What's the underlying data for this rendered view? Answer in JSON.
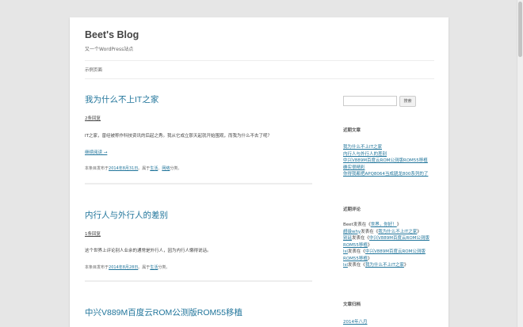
{
  "site": {
    "title": "Beet's Blog",
    "description": "又一个WordPress站点"
  },
  "nav": {
    "sample_page": "示例页面"
  },
  "posts": [
    {
      "title": "我为什么不上IT之家",
      "comments": "2条回复",
      "excerpt": "IT之家，曾经被称作科技资讯的后起之秀。我从它成立那天起就开始围观，而我为什么不去了呢？",
      "more": "继续阅读 →",
      "meta_prefix": "本条目发布于",
      "date": "2014年8月31日",
      "meta_mid": "。属于",
      "cat1": "生活",
      "meta_sep": "、",
      "cat2": "网络",
      "meta_suffix": "分类。"
    },
    {
      "title": "内行人与外行人的差别",
      "comments": "1条回复",
      "excerpt": "这个世界上评论别人业余的通常是外行人，因为内行人懒得说话。",
      "meta_prefix": "本条目发布于",
      "date": "2014年8月28日",
      "meta_mid": "。属于",
      "cat1": "生活",
      "meta_suffix": "分类。"
    },
    {
      "title": "中兴V889M百度云ROM公测版ROM55移植"
    }
  ],
  "sidebar": {
    "search_button": "搜索",
    "recent_posts_title": "近期文章",
    "recent_posts": [
      "我为什么不上IT之家",
      "内行人与外行人的差别",
      "中兴V889M百度云ROM公测版ROM55移植",
      "确实很精彩",
      "你得我都把APQ8064当成骁龙800系列的了"
    ],
    "recent_comments_title": "近期评论",
    "recent_comments": [
      {
        "author": "Beet",
        "text": "发表在《",
        "post": "世界，你好！",
        "end": "》"
      },
      {
        "author": "超级why",
        "text": "发表在《",
        "post": "我为什么不上IT之家",
        "end": "》"
      },
      {
        "author": "别延",
        "text": "发表在《",
        "post": "中兴V889M百度云ROM公测版ROM55移植",
        "end": "》"
      },
      {
        "author": "lsl",
        "text": "发表在《",
        "post": "中兴V889M百度云ROM公测版ROM55移植",
        "end": "》"
      },
      {
        "author": "lsl",
        "text": "发表在《",
        "post": "我为什么不上IT之家",
        "end": "》"
      }
    ],
    "archives_title": "文章归档",
    "archives": [
      "2014年八月"
    ]
  }
}
